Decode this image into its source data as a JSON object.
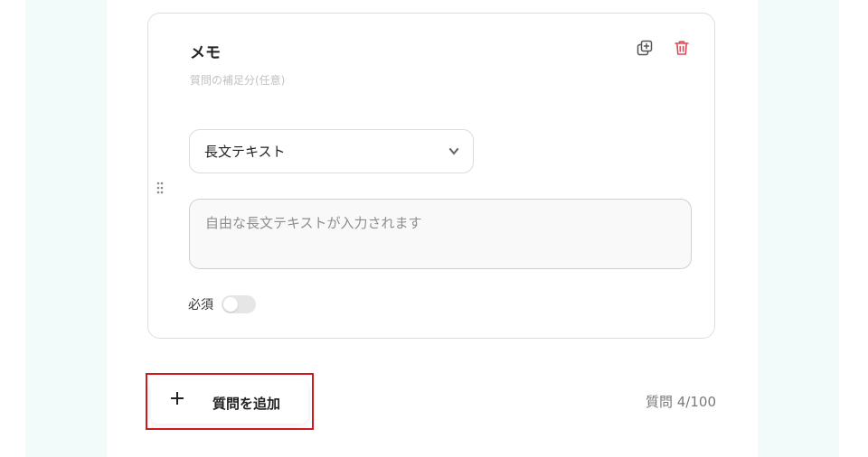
{
  "question": {
    "title": "メモ",
    "description_placeholder": "質問の補足分(任意)",
    "type_select": {
      "selected": "長文テキスト"
    },
    "answer_preview": {
      "placeholder": "自由な長文テキストが入力されます"
    },
    "required": {
      "label": "必須",
      "value": false
    },
    "icons": {
      "copy": "copy-icon",
      "delete": "trash-icon",
      "drag": "drag-handle-icon",
      "chevron": "chevron-down-icon"
    }
  },
  "footer": {
    "add_button_label": "質問を追加",
    "add_button_icon": "plus-icon",
    "question_count_label": "質問 4/100"
  },
  "colors": {
    "side_background": "#f2fbf9",
    "delete_icon": "#e04a56",
    "highlight_border": "#d0191d"
  }
}
